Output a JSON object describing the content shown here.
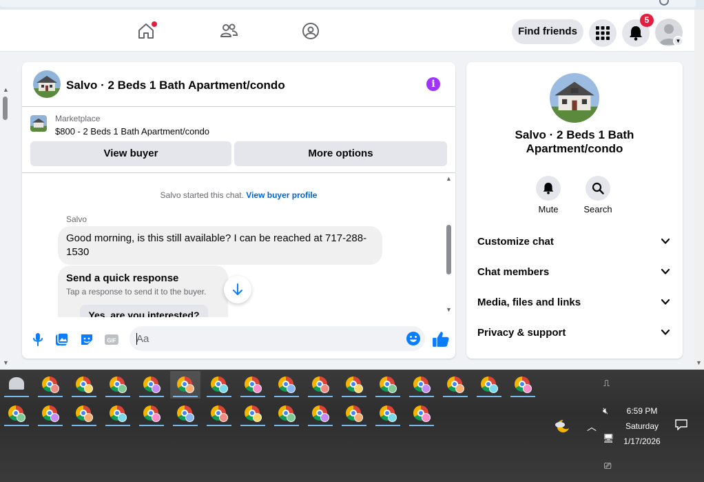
{
  "topbar": {
    "find_friends_label": "Find friends",
    "notification_count": "5"
  },
  "chat": {
    "header_title": "Salvo · 2 Beds 1 Bath Apartment/condo",
    "marketplace_label": "Marketplace",
    "listing_title": "$800 - 2 Beds 1 Bath Apartment/condo",
    "view_buyer_label": "View buyer",
    "more_options_label": "More options",
    "system_text": "Salvo started this chat.",
    "system_link": "View buyer profile",
    "sender_name": "Salvo",
    "message_text": "Good morning, is this still available? I can be reached at 717-288-1530",
    "quick_response_title": "Send a quick response",
    "quick_response_subtitle": "Tap a response to send it to the buyer.",
    "quick_response_option": "Yes, are you interested?",
    "input_placeholder": "Aa"
  },
  "side": {
    "title": "Salvo · 2 Beds 1 Bath Apartment/condo",
    "mute_label": "Mute",
    "search_label": "Search",
    "rows": [
      {
        "label": "Customize chat"
      },
      {
        "label": "Chat members"
      },
      {
        "label": "Media, files and links"
      },
      {
        "label": "Privacy & support"
      }
    ]
  },
  "taskbar": {
    "time": "6:59 PM",
    "day": "Saturday",
    "date": "1/17/2026"
  },
  "colors": {
    "accent": "#0a7cff",
    "info_purple": "#a033ff",
    "badge_red": "#e41e3f"
  }
}
